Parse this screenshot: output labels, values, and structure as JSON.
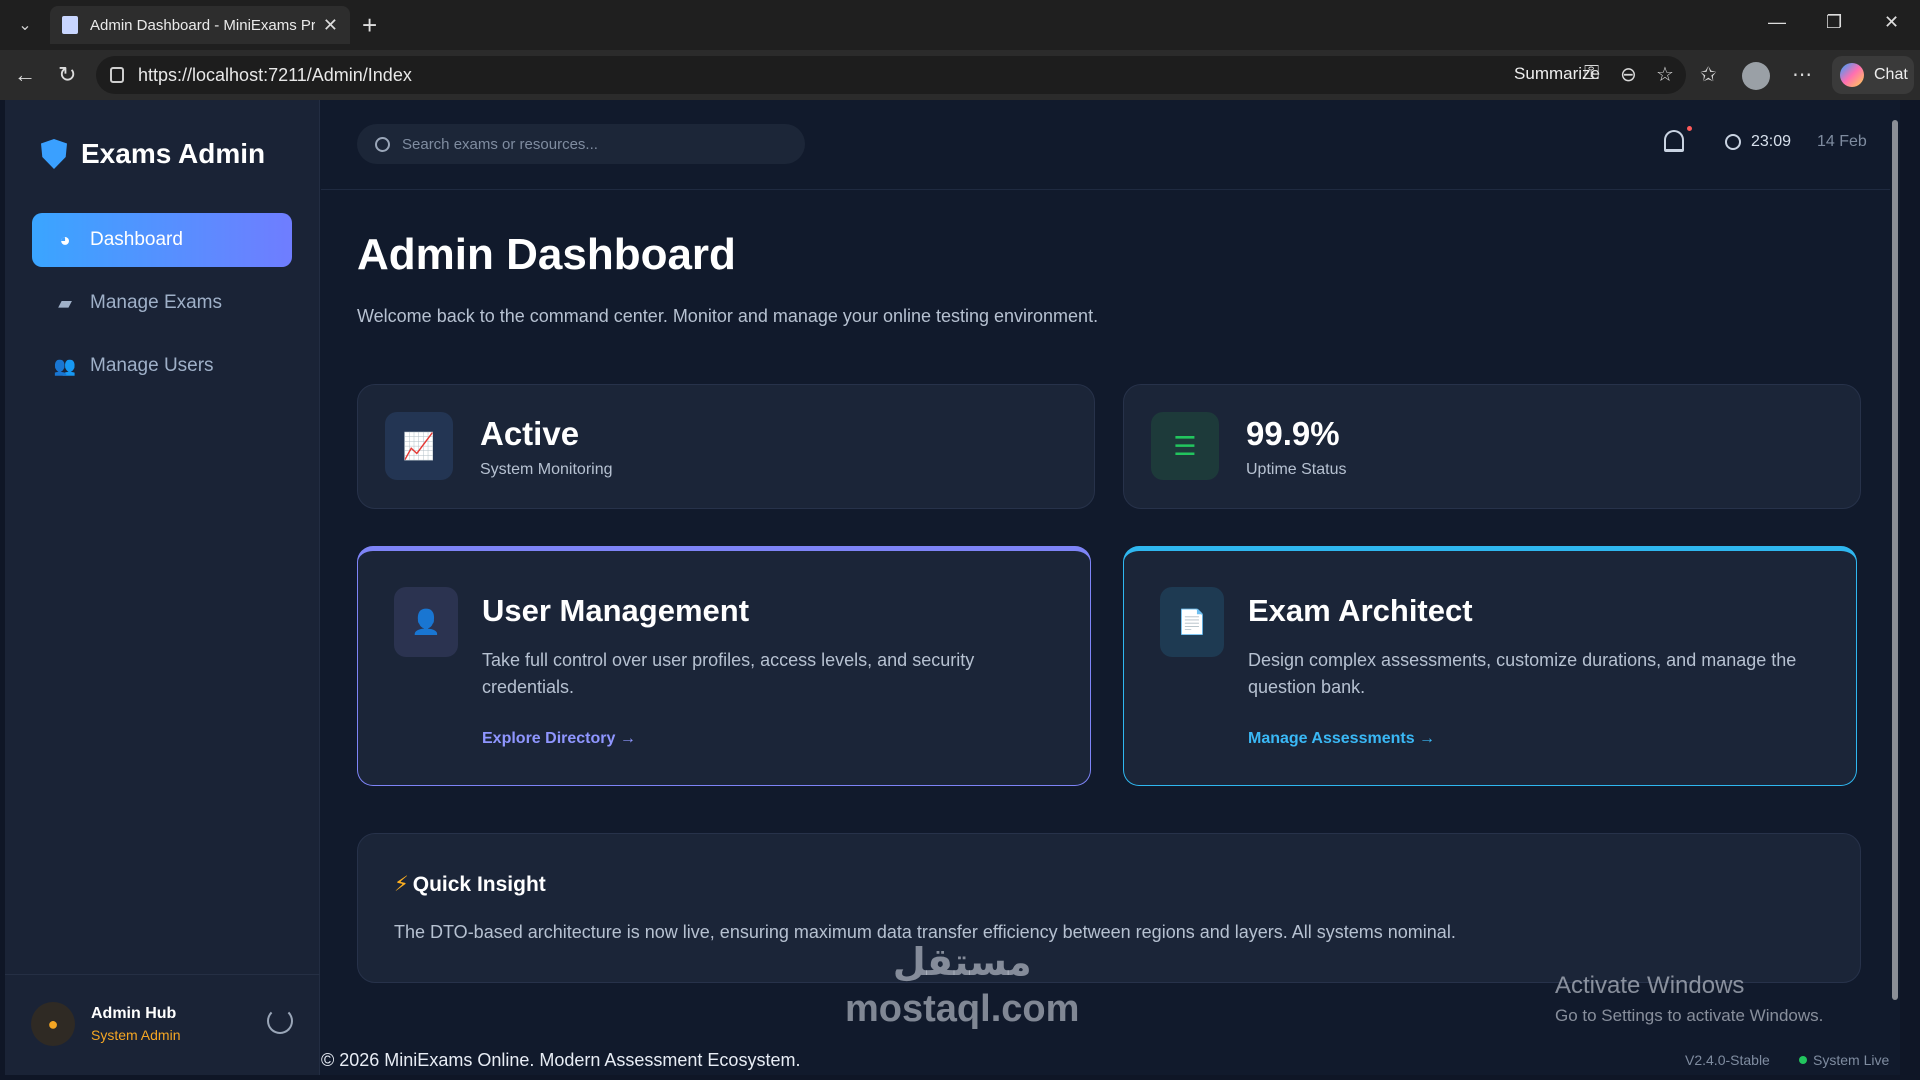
{
  "browser": {
    "tab_title": "Admin Dashboard - MiniExams Pro",
    "url": "https://localhost:7211/Admin/Index",
    "summarize_label": "Summarize",
    "chat_label": "Chat"
  },
  "sidebar": {
    "brand": "Exams Admin",
    "items": [
      {
        "label": "Dashboard",
        "icon": "pie-chart-icon",
        "active": true
      },
      {
        "label": "Manage Exams",
        "icon": "folder-icon",
        "active": false
      },
      {
        "label": "Manage Users",
        "icon": "users-icon",
        "active": false
      }
    ],
    "user": {
      "name": "Admin Hub",
      "role": "System Admin"
    }
  },
  "topbar": {
    "search_placeholder": "Search exams or resources...",
    "time": "23:09",
    "date": "14 Feb"
  },
  "main": {
    "title": "Admin Dashboard",
    "subtitle": "Welcome back to the command center. Monitor and manage your online testing environment.",
    "stats": [
      {
        "value": "Active",
        "label": "System Monitoring",
        "icon": "line-chart-icon"
      },
      {
        "value": "99.9%",
        "label": "Uptime Status",
        "icon": "server-icon"
      }
    ],
    "cards": [
      {
        "title": "User Management",
        "description": "Take full control over user profiles, access levels, and security credentials.",
        "link": "Explore Directory →",
        "icon": "user-shield-icon"
      },
      {
        "title": "Exam Architect",
        "description": "Design complex assessments, customize durations, and manage the question bank.",
        "link": "Manage Assessments →",
        "icon": "document-icon"
      }
    ],
    "insight": {
      "title": "Quick Insight",
      "text": "The DTO-based architecture is now live, ensuring maximum data transfer efficiency between regions and layers. All systems nominal."
    }
  },
  "footer": {
    "copyright": "© 2026 MiniExams Online. Modern Assessment Ecosystem.",
    "version": "V2.4.0-Stable",
    "status": "System Live"
  },
  "overlay": {
    "watermark_ar": "مستقل",
    "watermark_en": "mostaql.com",
    "activate_title": "Activate Windows",
    "activate_sub": "Go to Settings to activate Windows."
  },
  "colors": {
    "accent_blue": "#3aa5ff",
    "accent_violet": "#7e84f7",
    "accent_cyan": "#2fb7f0",
    "success": "#22c55e",
    "warning": "#f5a623"
  }
}
